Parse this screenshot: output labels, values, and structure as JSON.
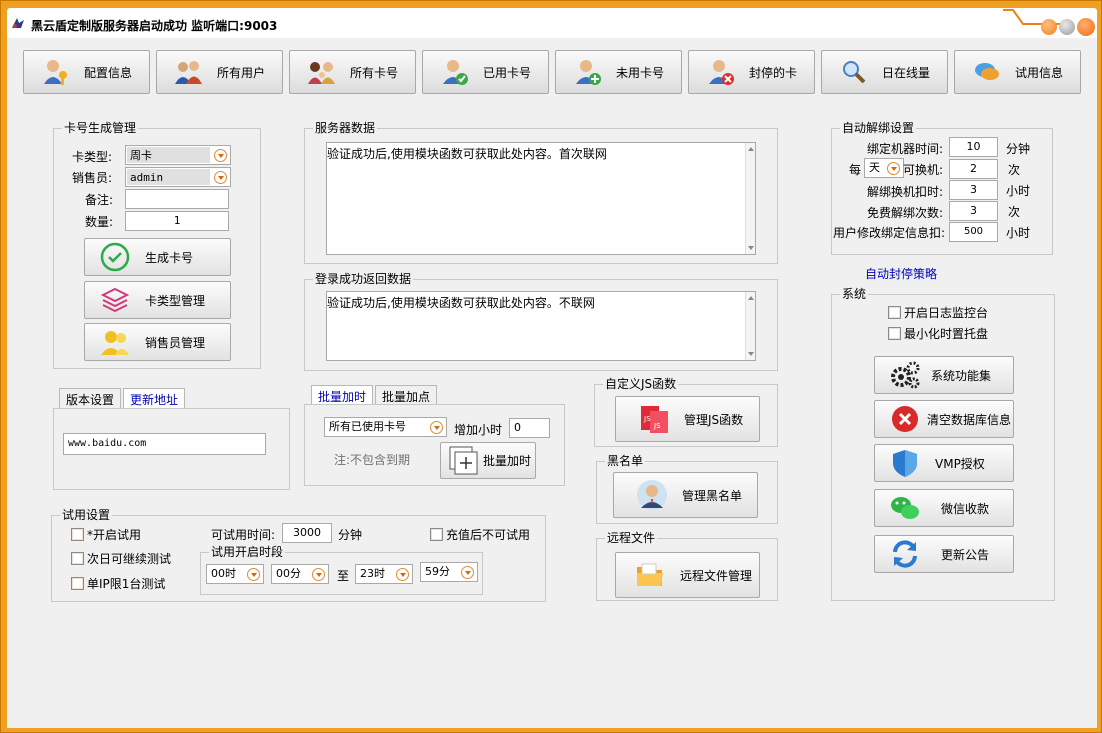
{
  "window": {
    "title": "黑云盾定制版服务器启动成功   监听端口:9003"
  },
  "toolbar": [
    {
      "label": "配置信息",
      "icon": "user-key-icon"
    },
    {
      "label": "所有用户",
      "icon": "users-icon"
    },
    {
      "label": "所有卡号",
      "icon": "family-icon"
    },
    {
      "label": "已用卡号",
      "icon": "user-check-icon"
    },
    {
      "label": "未用卡号",
      "icon": "user-add-icon"
    },
    {
      "label": "封停的卡",
      "icon": "user-remove-icon"
    },
    {
      "label": "日在线量",
      "icon": "magnifier-icon"
    },
    {
      "label": "试用信息",
      "icon": "chat-icon"
    }
  ],
  "card_gen": {
    "group_label": "卡号生成管理",
    "card_type_label": "卡类型:",
    "card_type_value": "周卡",
    "seller_label": "销售员:",
    "seller_value": "admin",
    "note_label": "备注:",
    "note_value": "",
    "qty_label": "数量:",
    "qty_value": "1",
    "btn_generate": "生成卡号",
    "btn_card_type": "卡类型管理",
    "btn_seller": "销售员管理"
  },
  "version": {
    "tab1": "版本设置",
    "tab2": "更新地址",
    "url_value": "www.baidu.com"
  },
  "trial": {
    "group_label": "试用设置",
    "enable_label": "*开启试用",
    "next_day_label": "次日可继续测试",
    "ip_limit_label": "单IP限1台测试",
    "time_label": "可试用时间:",
    "time_value": "3000",
    "time_unit": "分钟",
    "recharge_label": "充值后不可试用",
    "period_label": "试用开启时段",
    "start_hour": "00时",
    "start_min": "00分",
    "to_label": "至",
    "end_hour": "23时",
    "end_min": "59分"
  },
  "server_data": {
    "group_label": "服务器数据",
    "content": "验证成功后,使用模块函数可获取此处内容。首次联网"
  },
  "login_data": {
    "group_label": "登录成功返回数据",
    "content": "验证成功后,使用模块函数可获取此处内容。不联网"
  },
  "batch": {
    "tab1": "批量加时",
    "tab2": "批量加点",
    "scope_value": "所有已使用卡号",
    "add_hours_label": "增加小时",
    "add_hours_value": "0",
    "note": "注:不包含到期",
    "btn_label": "批量加时"
  },
  "js": {
    "group_label": "自定义JS函数",
    "btn_label": "管理JS函数"
  },
  "blacklist": {
    "group_label": "黑名单",
    "btn_label": "管理黑名单"
  },
  "remote": {
    "group_label": "远程文件",
    "btn_label": "远程文件管理"
  },
  "auto_unbind": {
    "group_label": "自动解绑设置",
    "bind_time_label": "绑定机器时间:",
    "bind_time_value": "10",
    "bind_time_unit": "分钟",
    "per_label": "每",
    "per_value": "天",
    "change_label": "可换机:",
    "change_value": "2",
    "change_unit": "次",
    "deduct_label": "解绑换机扣时:",
    "deduct_value": "3",
    "deduct_unit": "小时",
    "free_label": "免费解绑次数:",
    "free_value": "3",
    "free_unit": "次",
    "modify_label": "用户修改绑定信息扣:",
    "modify_value": "500",
    "modify_unit": "小时",
    "ban_strategy_link": "自动封停策略"
  },
  "system": {
    "group_label": "系统",
    "log_label": "开启日志监控台",
    "tray_label": "最小化时置托盘",
    "btn_functions": "系统功能集",
    "btn_clear": "清空数据库信息",
    "btn_vmp": "VMP授权",
    "btn_wechat": "微信收款",
    "btn_notice": "更新公告"
  },
  "colors": {
    "frame": "#f0a020",
    "accent_orange": "#f07f1a",
    "link_blue": "#0000c0"
  }
}
